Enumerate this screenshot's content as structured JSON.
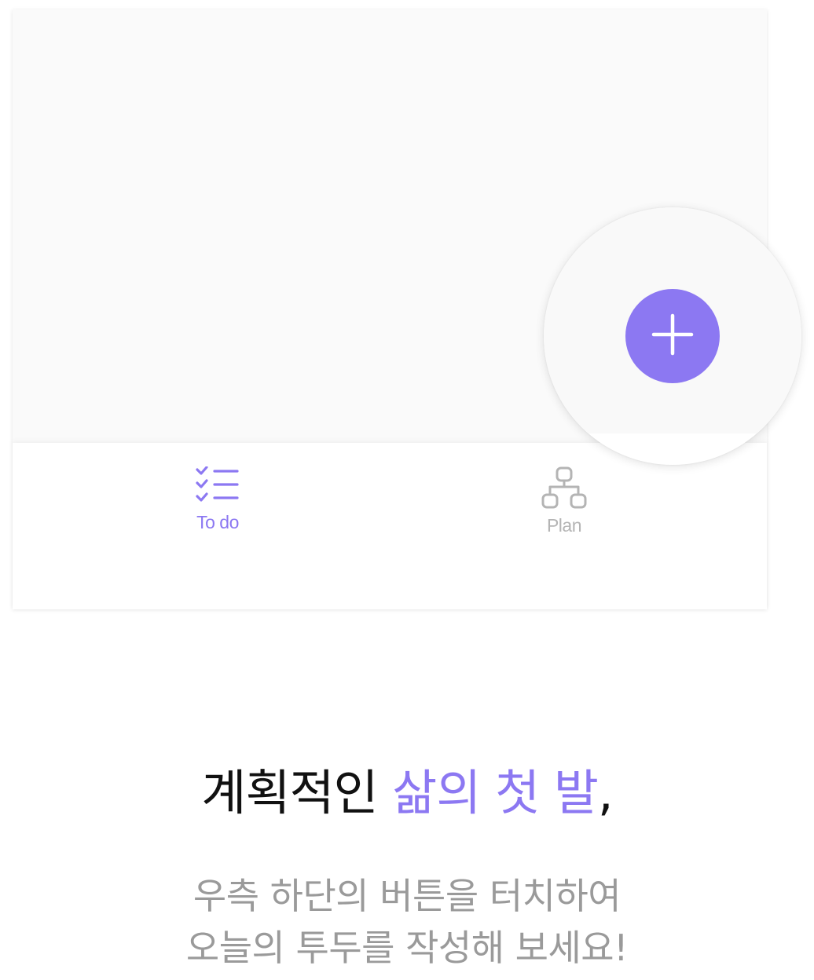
{
  "tabs": [
    {
      "label": "To do",
      "icon": "checklist-icon",
      "active": true
    },
    {
      "label": "Plan",
      "icon": "hierarchy-icon",
      "active": false
    }
  ],
  "fab": {
    "icon": "plus-icon"
  },
  "headline": {
    "part1": "계획적인 ",
    "accent": "삶의 첫 발",
    "part2": ","
  },
  "subtext": {
    "line1": "우측 하단의 버튼을 터치하여",
    "line2": "오늘의 투두를 작성해 보세요!"
  },
  "colors": {
    "accent": "#8c78f2",
    "inactive": "#b4b4b4",
    "subtext": "#9a9a9a"
  }
}
